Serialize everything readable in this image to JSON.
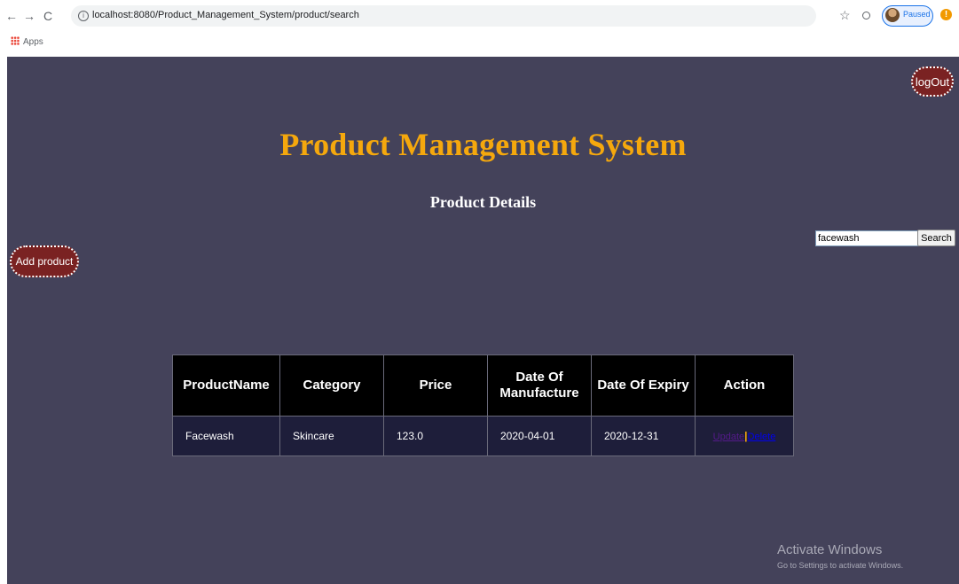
{
  "browser": {
    "back_icon": "←",
    "forward_icon": "→",
    "reload_icon": "C",
    "url": "localhost:8080/Product_Management_System/product/search",
    "profile_status": "Paused",
    "bookmarks_apps_label": "Apps"
  },
  "header": {
    "logout_label": "logOut",
    "title": "Product Management System",
    "subtitle": "Product Details"
  },
  "search": {
    "value": "facewash",
    "button_label": "Search"
  },
  "add_product_label": "Add product",
  "table": {
    "headers": [
      "ProductName",
      "Category",
      "Price",
      "Date Of Manufacture",
      "Date Of Expiry",
      "Action"
    ],
    "rows": [
      {
        "name": "Facewash",
        "category": "Skincare",
        "price": "123.0",
        "manufacture": "2020-04-01",
        "expiry": "2020-12-31",
        "update_label": "Update",
        "separator": "|",
        "delete_label": "Delete"
      }
    ]
  },
  "watermark": {
    "line1": "Activate Windows",
    "line2": "Go to Settings to activate Windows."
  },
  "colors": {
    "page_bg": "#44425a",
    "title": "#f5a80d",
    "button_bg": "#7a2222",
    "header_cell": "#000000",
    "body_cell": "#1e1e3a"
  }
}
